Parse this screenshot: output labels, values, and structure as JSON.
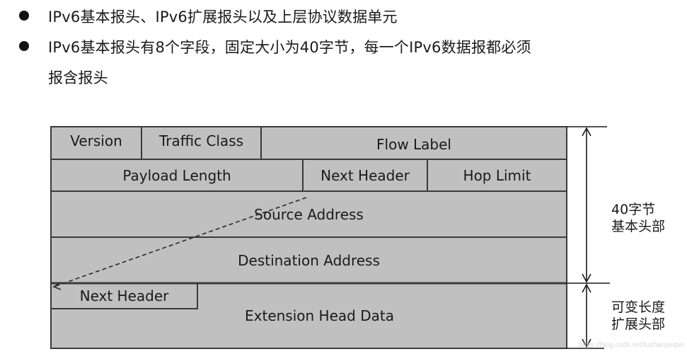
{
  "bullets": [
    {
      "lines": [
        "IPv6基本报头、IPv6扩展报头以及上层协议数据单元"
      ]
    },
    {
      "lines": [
        "IPv6基本报头有8个字段，固定大小为40字节，每一个IPv6数据报都必须",
        "报含报头"
      ]
    }
  ],
  "diagram": {
    "row1": {
      "version": "Version",
      "traffic_class": "Traffic Class",
      "flow_label": "Flow Label"
    },
    "row2": {
      "payload_length": "Payload Length",
      "next_header": "Next Header",
      "hop_limit": "Hop Limit"
    },
    "source_address": "Source Address",
    "destination_address": "Destination Address",
    "extension": {
      "next_header": "Next Header",
      "data": "Extension Head Data"
    },
    "basic_header_label": [
      "40字节",
      "基本头部"
    ],
    "extension_header_label": [
      "可变长度",
      "扩展头部"
    ],
    "colors": {
      "field_fill": "#c0c0c0",
      "border": "#3a3a3a"
    }
  },
  "watermark": "https://blog.csdn.net/lushanpeipei"
}
